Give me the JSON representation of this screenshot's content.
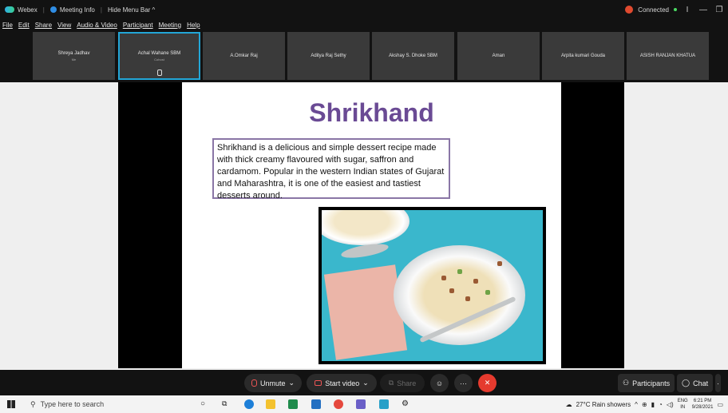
{
  "titlebar": {
    "app_name": "Webex",
    "meeting_info": "Meeting Info",
    "hide_menu": "Hide Menu Bar ^",
    "status": "Connected",
    "status_color": "#e04a2f"
  },
  "menu": [
    "File",
    "Edit",
    "Share",
    "View",
    "Audio & Video",
    "Participant",
    "Meeting",
    "Help"
  ],
  "participants": [
    {
      "name": "Shreya Jadhav",
      "role": "Me"
    },
    {
      "name": "Achal Wahane SBM",
      "role": "Cohost"
    },
    {
      "name": "A.Omkar Raj",
      "role": ""
    },
    {
      "name": "Aditya Raj Sethy",
      "role": ""
    },
    {
      "name": "Akshay S. Dhoke SBM",
      "role": ""
    },
    {
      "name": "Aman",
      "role": ""
    },
    {
      "name": "Arpita kumari Gouda",
      "role": ""
    },
    {
      "name": "ASISH RANJAN KHATUA",
      "role": ""
    }
  ],
  "slide": {
    "title": "Shrikhand",
    "text": "Shrikhand is a delicious and simple dessert recipe made with thick creamy flavoured with sugar, saffron and cardamom. Popular in the western Indian states of Gujarat and Maharashtra, it is one of the easiest and tastiest desserts around.",
    "title_color": "#6a4a94"
  },
  "controls": {
    "unmute": "Unmute",
    "start_video": "Start video",
    "share": "Share",
    "participants": "Participants",
    "chat": "Chat"
  },
  "taskbar": {
    "search_placeholder": "Type here to search",
    "weather": "27°C  Rain showers",
    "lang": "ENG",
    "region": "IN",
    "time": "6:21 PM",
    "date": "9/28/2021"
  }
}
